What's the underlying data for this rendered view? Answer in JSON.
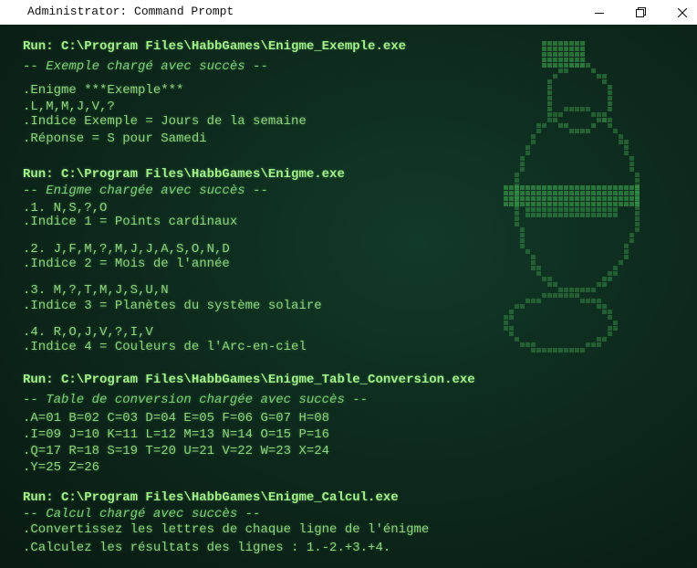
{
  "window": {
    "title": "Administrator: Command Prompt",
    "controls": {
      "minimize": "minimize-icon",
      "maximize": "maximize-icon",
      "close": "close-icon"
    }
  },
  "colors": {
    "text": "#8fd47f",
    "run": "#a4f08c",
    "background": "#0a1f16",
    "art": "#2f7a3f",
    "art_bright": "#3fae52"
  },
  "console": {
    "lines": [
      {
        "kind": "run",
        "text": "Run: C:\\Program Files\\HabbGames\\Enigme_Exemple.exe"
      },
      {
        "kind": "msg",
        "text": "-- Exemple chargé avec succès --"
      },
      {
        "kind": "txt",
        "text": ".Enigme ***Exemple***"
      },
      {
        "kind": "txt",
        "text": ".L,M,M,J,V,?"
      },
      {
        "kind": "txt",
        "text": ".Indice Exemple = Jours de la semaine"
      },
      {
        "kind": "txt",
        "text": ".Réponse = S pour Samedi"
      },
      {
        "kind": "run",
        "text": "Run: C:\\Program Files\\HabbGames\\Enigme.exe"
      },
      {
        "kind": "msg",
        "text": "-- Enigme chargée avec succès --"
      },
      {
        "kind": "txt",
        "text": ".1. N,S,?,O"
      },
      {
        "kind": "txt",
        "text": ".Indice 1 = Points cardinaux"
      },
      {
        "kind": "txt",
        "text": ".2. J,F,M,?,M,J,J,A,S,O,N,D"
      },
      {
        "kind": "txt",
        "text": ".Indice 2 = Mois de l'année"
      },
      {
        "kind": "txt",
        "text": ".3. M,?,T,M,J,S,U,N"
      },
      {
        "kind": "txt",
        "text": ".Indice 3 = Planètes du système solaire"
      },
      {
        "kind": "txt",
        "text": ".4. R,O,J,V,?,I,V"
      },
      {
        "kind": "txt",
        "text": ".Indice 4 = Couleurs de l'Arc-en-ciel"
      },
      {
        "kind": "run",
        "text": "Run: C:\\Program Files\\HabbGames\\Enigme_Table_Conversion.exe"
      },
      {
        "kind": "msg",
        "text": "-- Table de conversion chargée avec succès --"
      },
      {
        "kind": "txt",
        "text": ".A=01 B=02 C=03 D=04 E=05 F=06 G=07 H=08"
      },
      {
        "kind": "txt",
        "text": ".I=09 J=10 K=11 L=12 M=13 N=14 O=15 P=16"
      },
      {
        "kind": "txt",
        "text": ".Q=17 R=18 S=19 T=20 U=21 V=22 W=23 X=24"
      },
      {
        "kind": "txt",
        "text": ".Y=25 Z=26"
      },
      {
        "kind": "run",
        "text": "Run: C:\\Program Files\\HabbGames\\Enigme_Calcul.exe"
      },
      {
        "kind": "msg",
        "text": "-- Calcul chargé avec succès --"
      },
      {
        "kind": "txt",
        "text": ".Convertissez les lettres de chaque ligne de l'énigme"
      },
      {
        "kind": "txt",
        "text": ".Calculez les résultats des lignes : 1.-2.+3.+4."
      }
    ]
  },
  "decoration": {
    "icon": "pixel-potion-bottle-icon"
  }
}
